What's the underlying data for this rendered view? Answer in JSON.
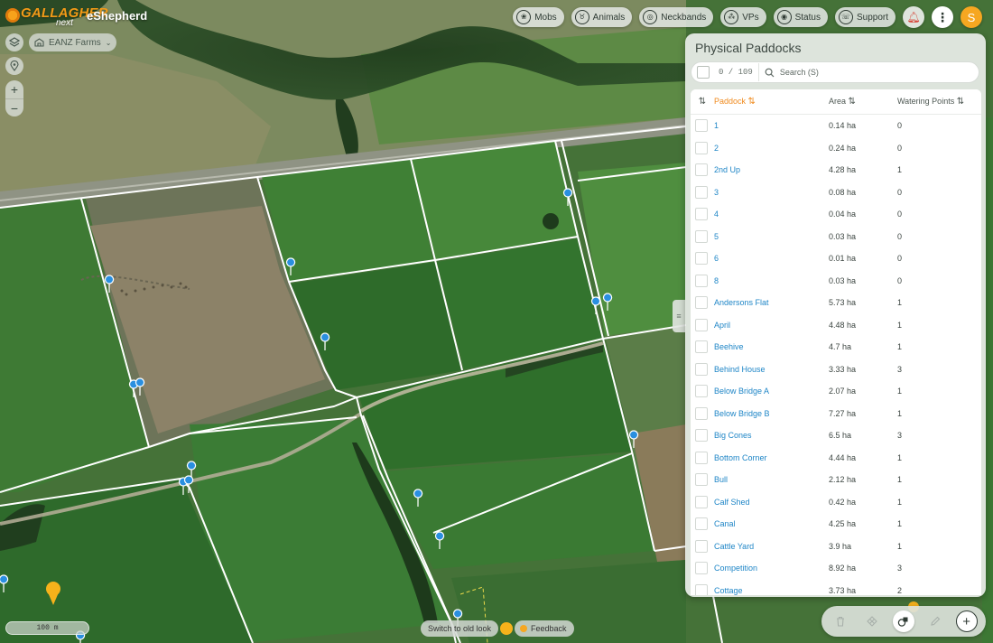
{
  "app": {
    "brand": "GALLAGHER",
    "brand_sub": "next",
    "name": "eShepherd"
  },
  "nav": [
    {
      "label": "Mobs",
      "icon": "sheep-icon"
    },
    {
      "label": "Animals",
      "icon": "cow-icon"
    },
    {
      "label": "Neckbands",
      "icon": "collar-icon"
    },
    {
      "label": "VPs",
      "icon": "fence-icon"
    },
    {
      "label": "Status",
      "icon": "status-icon"
    },
    {
      "label": "Support",
      "icon": "support-icon"
    }
  ],
  "user": {
    "initial": "S"
  },
  "farm": {
    "selected": "EANZ Farms"
  },
  "panel": {
    "title": "Physical Paddocks",
    "selected_count": "0 / 109",
    "search_placeholder": "Search (S)",
    "columns": {
      "paddock": "Paddock",
      "area": "Area",
      "watering_points": "Watering Points"
    },
    "sort": {
      "column": "Paddock",
      "direction": "ascending"
    },
    "rows": [
      {
        "name": "1",
        "area": "0.14 ha",
        "water": "0"
      },
      {
        "name": "2",
        "area": "0.24 ha",
        "water": "0"
      },
      {
        "name": "2nd Up",
        "area": "4.28 ha",
        "water": "1"
      },
      {
        "name": "3",
        "area": "0.08 ha",
        "water": "0"
      },
      {
        "name": "4",
        "area": "0.04 ha",
        "water": "0"
      },
      {
        "name": "5",
        "area": "0.03 ha",
        "water": "0"
      },
      {
        "name": "6",
        "area": "0.01 ha",
        "water": "0"
      },
      {
        "name": "8",
        "area": "0.03 ha",
        "water": "0"
      },
      {
        "name": "Andersons Flat",
        "area": "5.73 ha",
        "water": "1"
      },
      {
        "name": "April",
        "area": "4.48 ha",
        "water": "1"
      },
      {
        "name": "Beehive",
        "area": "4.7 ha",
        "water": "1"
      },
      {
        "name": "Behind House",
        "area": "3.33 ha",
        "water": "3"
      },
      {
        "name": "Below Bridge A",
        "area": "2.07 ha",
        "water": "1"
      },
      {
        "name": "Below Bridge B",
        "area": "7.27 ha",
        "water": "1"
      },
      {
        "name": "Big Cones",
        "area": "6.5 ha",
        "water": "3"
      },
      {
        "name": "Bottom Corner",
        "area": "4.44 ha",
        "water": "1"
      },
      {
        "name": "Bull",
        "area": "2.12 ha",
        "water": "1"
      },
      {
        "name": "Calf Shed",
        "area": "0.42 ha",
        "water": "1"
      },
      {
        "name": "Canal",
        "area": "4.25 ha",
        "water": "1"
      },
      {
        "name": "Cattle Yard",
        "area": "3.9 ha",
        "water": "1"
      },
      {
        "name": "Competition",
        "area": "8.92 ha",
        "water": "3"
      },
      {
        "name": "Cottage",
        "area": "3.73 ha",
        "water": "2"
      }
    ]
  },
  "map": {
    "scale_label": "100 m",
    "switch_label": "Switch to old look",
    "feedback_label": "Feedback"
  },
  "colors": {
    "accent": "#f6a721",
    "link": "#1f86c7",
    "sort_active": "#f08a1d"
  }
}
